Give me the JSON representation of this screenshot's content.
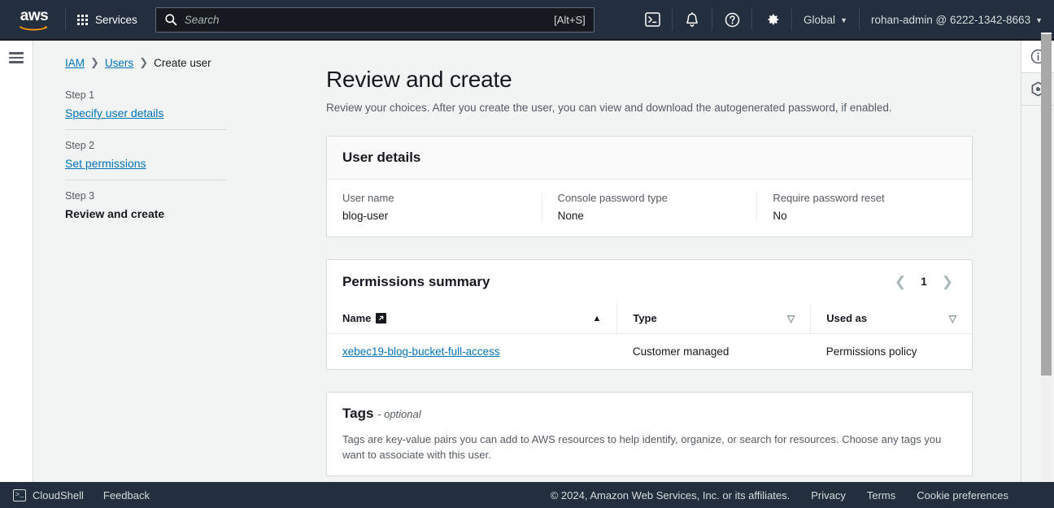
{
  "topnav": {
    "logo_alt": "aws",
    "services_label": "Services",
    "search": {
      "placeholder": "Search",
      "value": "",
      "shortcut": "[Alt+S]"
    },
    "region_label": "Global",
    "region_caret": "▼",
    "account_label": "rohan-admin @ 6222-1342-8663",
    "account_caret": "▼",
    "icons": {
      "cloudshell": "cloudshell-icon",
      "notifications": "bell-icon",
      "help": "help-circle-icon",
      "settings": "gear-icon"
    }
  },
  "breadcrumb": {
    "items": [
      {
        "label": "IAM",
        "link": true
      },
      {
        "label": "Users",
        "link": true
      },
      {
        "label": "Create user",
        "link": false
      }
    ],
    "separator": "❯"
  },
  "steps": [
    {
      "step": "Step 1",
      "name": "Specify user details",
      "active": false
    },
    {
      "step": "Step 2",
      "name": "Set permissions",
      "active": false
    },
    {
      "step": "Step 3",
      "name": "Review and create",
      "active": true
    }
  ],
  "main": {
    "title": "Review and create",
    "description": "Review your choices. After you create the user, you can view and download the autogenerated password, if enabled."
  },
  "user_details": {
    "title": "User details",
    "fields": [
      {
        "label": "User name",
        "value": "blog-user"
      },
      {
        "label": "Console password type",
        "value": "None"
      },
      {
        "label": "Require password reset",
        "value": "No"
      }
    ]
  },
  "permissions_summary": {
    "title": "Permissions summary",
    "pagination": {
      "prev": "❮",
      "page": "1",
      "next": "❯"
    },
    "columns": [
      {
        "label": "Name",
        "sort": "asc",
        "sort_glyph": "▲",
        "external_link": true
      },
      {
        "label": "Type",
        "sort": "none",
        "sort_glyph": "▽",
        "external_link": false
      },
      {
        "label": "Used as",
        "sort": "none",
        "sort_glyph": "▽",
        "external_link": false
      }
    ],
    "rows": [
      {
        "name": "xebec19-blog-bucket-full-access",
        "type": "Customer managed",
        "used_as": "Permissions policy"
      }
    ]
  },
  "tags": {
    "title": "Tags",
    "optional_suffix": "- optional",
    "description": "Tags are key-value pairs you can add to AWS resources to help identify, organize, or search for resources. Choose any tags you want to associate with this user."
  },
  "right_rail": {
    "info_icon": "info-circle-icon",
    "hex_icon": "hexagon-icon"
  },
  "footer": {
    "cloudshell": "CloudShell",
    "feedback": "Feedback",
    "copyright": "© 2024, Amazon Web Services, Inc. or its affiliates.",
    "privacy": "Privacy",
    "terms": "Terms",
    "cookies": "Cookie preferences"
  },
  "colors": {
    "nav_bg": "#232f3e",
    "link": "#0073bb",
    "page_bg": "#f2f3f3",
    "text": "#16191f",
    "muted": "#545b64"
  }
}
